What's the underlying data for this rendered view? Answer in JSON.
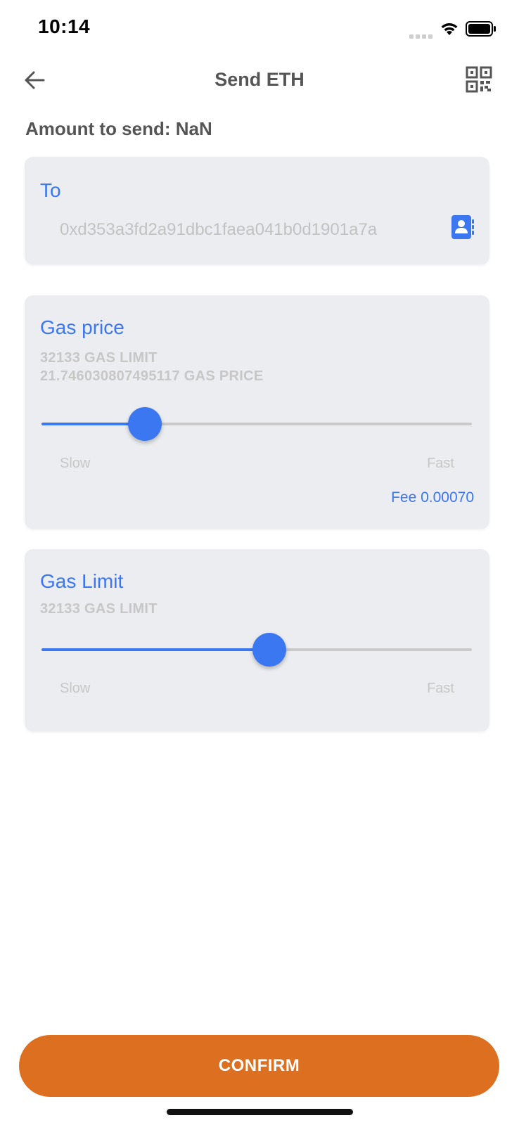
{
  "status_bar": {
    "time": "10:14"
  },
  "header": {
    "title": "Send ETH",
    "back_icon": "arrow-left-icon",
    "scan_icon": "qr-code-icon"
  },
  "amount": {
    "label": "Amount to send: NaN"
  },
  "to_card": {
    "title": "To",
    "address_placeholder": "0xd353a3fd2a91dbc1faea041b0d1901a7a",
    "contacts_icon": "contacts-book-icon"
  },
  "gas_price_card": {
    "title": "Gas price",
    "gas_limit_line": "32133 GAS LIMIT",
    "gas_price_line": "21.746030807495117 GAS PRICE",
    "slider_level": 0.24,
    "slow_label": "Slow",
    "fast_label": "Fast",
    "fee_label": "Fee 0.00070"
  },
  "gas_limit_card": {
    "title": "Gas Limit",
    "gas_limit_line": "32133 GAS LIMIT",
    "slider_level": 0.53,
    "slow_label": "Slow",
    "fast_label": "Fast"
  },
  "confirm": {
    "label": "CONFIRM"
  },
  "colors": {
    "accent": "#3c77f2",
    "card_background": "#ebedf0",
    "confirm_button": "#dc7020",
    "muted_text": "#c7c7c7"
  }
}
